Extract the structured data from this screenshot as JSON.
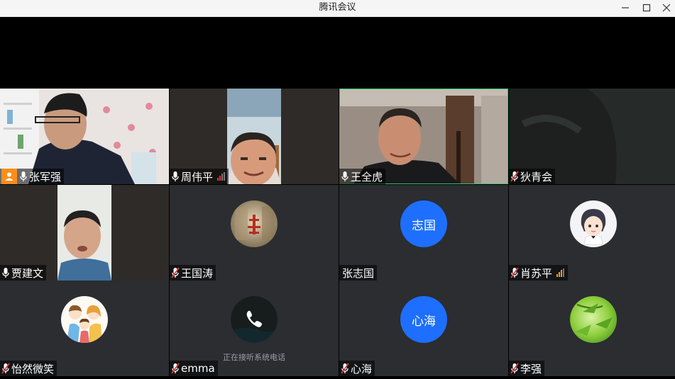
{
  "window": {
    "title": "腾讯会议"
  },
  "participants": [
    {
      "name": "张军强",
      "mic": "on",
      "host": true,
      "signal": null
    },
    {
      "name": "周伟平",
      "mic": "on",
      "host": false,
      "signal": "weak"
    },
    {
      "name": "王全虎",
      "mic": "on",
      "host": false,
      "signal": null,
      "speaking": true
    },
    {
      "name": "狄青会",
      "mic": "muted",
      "host": false,
      "signal": null
    },
    {
      "name": "贾建文",
      "mic": "on",
      "host": false,
      "signal": null
    },
    {
      "name": "王国涛",
      "mic": "muted",
      "host": false,
      "signal": null,
      "avatar": "calligraphy-avatar"
    },
    {
      "name": "张志国",
      "mic": "none",
      "host": false,
      "signal": null,
      "avatar_text": "志国"
    },
    {
      "name": "肖苏平",
      "mic": "muted",
      "host": false,
      "signal": "medium",
      "avatar": "cartoon-girl-avatar"
    },
    {
      "name": "怡然微笑",
      "mic": "muted",
      "host": false,
      "signal": null,
      "avatar": "family-cartoon-avatar"
    },
    {
      "name": "emma",
      "mic": "muted",
      "host": false,
      "signal": null,
      "avatar": "phone-call-avatar",
      "status": "正在接听系统电话"
    },
    {
      "name": "心海",
      "mic": "muted",
      "host": false,
      "signal": null,
      "avatar_text": "心海"
    },
    {
      "name": "李强",
      "mic": "muted",
      "host": false,
      "signal": null,
      "avatar": "bamboo-avatar"
    }
  ],
  "colors": {
    "tile_bg": "#2b2d31",
    "avatar_blue": "#1e6fff",
    "host_orange": "#ff8d1a",
    "speaking_border": "#2ecc71",
    "signal_weak": "#e03c3c",
    "signal_medium": "#f59a23"
  }
}
